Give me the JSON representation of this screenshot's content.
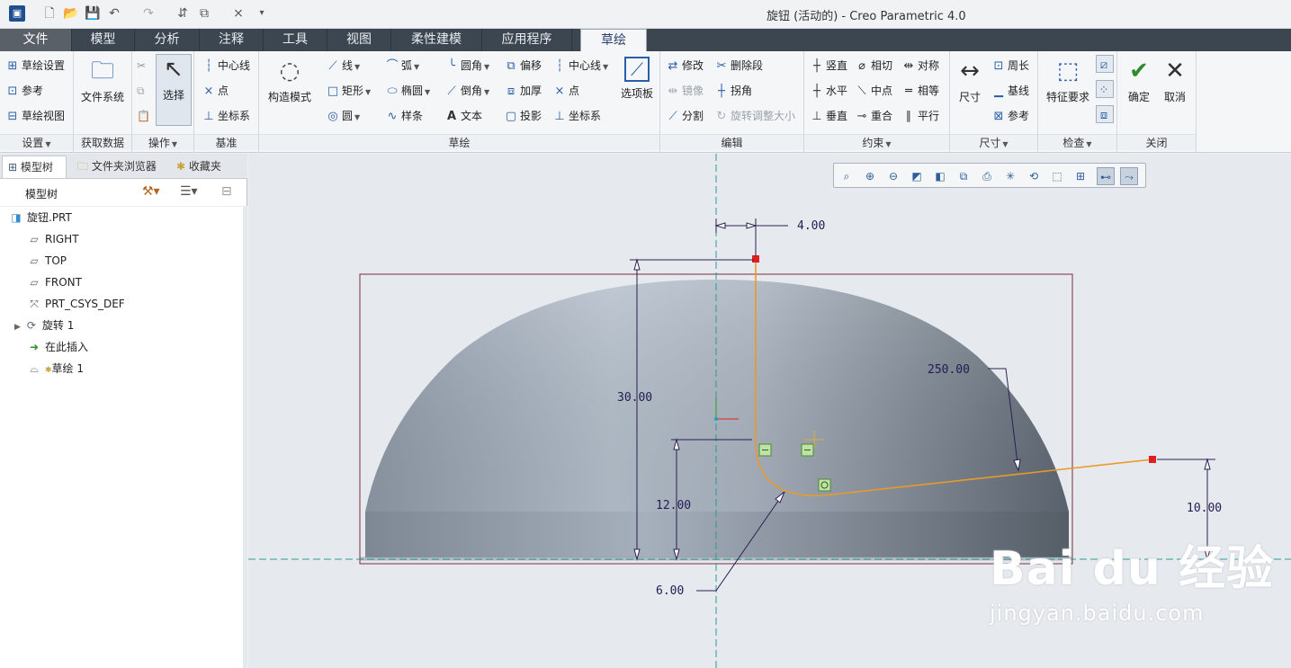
{
  "window": {
    "title": "旋钮 (活动的) - Creo Parametric 4.0"
  },
  "tabs": [
    {
      "label": "文件"
    },
    {
      "label": "模型"
    },
    {
      "label": "分析"
    },
    {
      "label": "注释"
    },
    {
      "label": "工具"
    },
    {
      "label": "视图"
    },
    {
      "label": "柔性建模"
    },
    {
      "label": "应用程序"
    },
    {
      "label": "草绘"
    }
  ],
  "ribbon": {
    "setup": {
      "label": "设置",
      "items": [
        "草绘设置",
        "参考",
        "草绘视图"
      ]
    },
    "get_data": {
      "label": "获取数据",
      "file_system": "文件系统"
    },
    "operations": {
      "label": "操作",
      "select": "选择"
    },
    "datum": {
      "label": "基准",
      "items": [
        "中心线",
        "点",
        "坐标系"
      ]
    },
    "sketching": {
      "label": "草绘",
      "construction": "构造模式",
      "col1": [
        "线",
        "矩形",
        "圆"
      ],
      "col2": [
        "弧",
        "椭圆",
        "样条"
      ],
      "col3": [
        "圆角",
        "倒角",
        "文本"
      ],
      "col4": [
        "偏移",
        "加厚",
        "投影"
      ],
      "col5": [
        "中心线",
        "点",
        "坐标系"
      ],
      "palette": "选项板"
    },
    "editing": {
      "label": "编辑",
      "items": [
        "修改",
        "删除段",
        "镜像",
        "拐角",
        "分割",
        "旋转调整大小"
      ]
    },
    "constrain": {
      "label": "约束",
      "items": [
        "竖直",
        "相切",
        "对称",
        "水平",
        "中点",
        "相等",
        "垂直",
        "重合",
        "平行"
      ]
    },
    "dimension": {
      "label": "尺寸",
      "dim": "尺寸",
      "items": [
        "周长",
        "基线",
        "参考"
      ]
    },
    "inspect": {
      "label": "检查",
      "feature": "特征要求"
    },
    "close": {
      "label": "关闭",
      "ok": "确定",
      "cancel": "取消"
    }
  },
  "left_panel": {
    "tabs": [
      "模型树",
      "文件夹浏览器",
      "收藏夹"
    ],
    "header": "模型树",
    "tree": [
      {
        "label": "旋钮.PRT",
        "icon": "part-icon"
      },
      {
        "label": "RIGHT",
        "icon": "datum-plane-icon"
      },
      {
        "label": "TOP",
        "icon": "datum-plane-icon"
      },
      {
        "label": "FRONT",
        "icon": "datum-plane-icon"
      },
      {
        "label": "PRT_CSYS_DEF",
        "icon": "csys-icon"
      },
      {
        "label": "旋转 1",
        "icon": "revolve-icon"
      },
      {
        "label": "在此插入",
        "icon": "insert-arrow-icon"
      },
      {
        "label": "草绘 1",
        "icon": "sketch-icon"
      }
    ]
  },
  "sketch": {
    "dimensions": {
      "d1": "4.00",
      "d2": "250.00",
      "d3": "30.00",
      "d4": "12.00",
      "d5": "10.00",
      "d6": "6.00"
    }
  },
  "watermark": {
    "logo": "Bai du 经验",
    "url": "jingyan.baidu.com"
  }
}
